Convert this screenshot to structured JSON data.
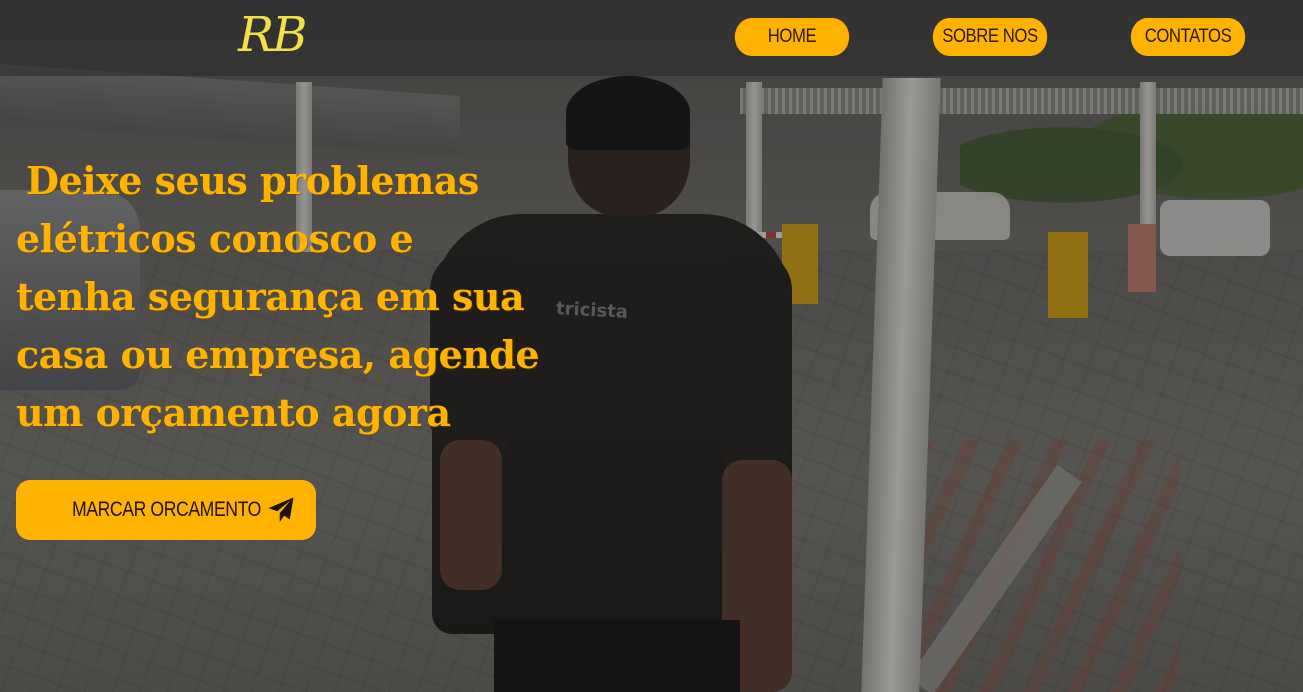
{
  "header": {
    "logo": "RB",
    "nav": [
      {
        "label": "HOME"
      },
      {
        "label": "SOBRE NOS"
      },
      {
        "label": "CONTATOS"
      }
    ]
  },
  "hero": {
    "headline_lines": [
      "Deixe seus problemas",
      "elétricos conosco e",
      "tenha segurança em sua",
      "casa ou empresa, agende",
      "um orçamento agora"
    ],
    "shirt_text": "tricista",
    "cta": {
      "label": "MARCAR ORCAMENTO",
      "icon": "paper-plane-icon"
    }
  },
  "colors": {
    "accent": "#ffb300",
    "logo": "#f2e04a",
    "header_bg": "rgba(40,40,40,0.55)"
  }
}
